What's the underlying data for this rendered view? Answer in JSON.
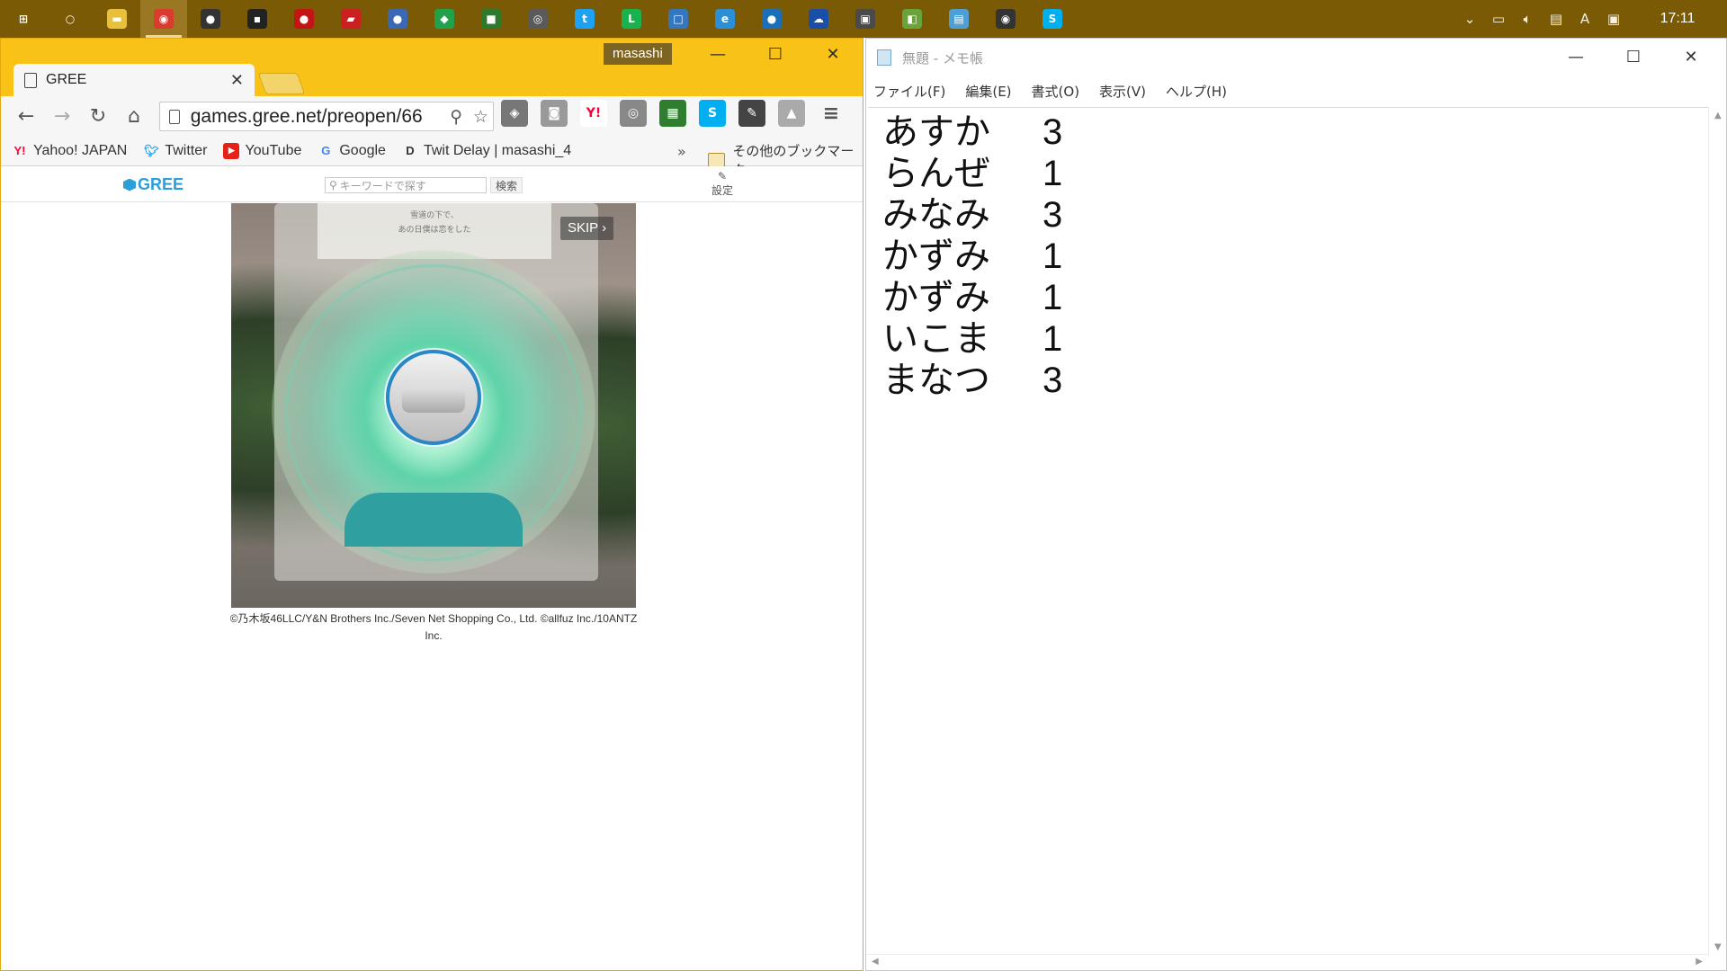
{
  "taskbar": {
    "items": [
      {
        "name": "start",
        "label": "⊞",
        "color": "#7a5a05"
      },
      {
        "name": "cortana",
        "label": "○",
        "color": "#7a5a05"
      },
      {
        "name": "explorer",
        "label": "▬",
        "color": "#e8c03c"
      },
      {
        "name": "chrome",
        "label": "◉",
        "color": "#d93b2f"
      },
      {
        "name": "app-1",
        "label": "●",
        "color": "#333333"
      },
      {
        "name": "app-2",
        "label": "▪",
        "color": "#222222"
      },
      {
        "name": "app-3",
        "label": "●",
        "color": "#c41515"
      },
      {
        "name": "app-4",
        "label": "▰",
        "color": "#cc2020"
      },
      {
        "name": "app-5",
        "label": "●",
        "color": "#3a68b5"
      },
      {
        "name": "app-6",
        "label": "◆",
        "color": "#22a14b"
      },
      {
        "name": "app-7",
        "label": "■",
        "color": "#2d7a2d"
      },
      {
        "name": "app-8",
        "label": "◎",
        "color": "#5a5a5a"
      },
      {
        "name": "twitter",
        "label": "t",
        "color": "#1da1f2"
      },
      {
        "name": "line",
        "label": "L",
        "color": "#19b24f"
      },
      {
        "name": "app-9",
        "label": "□",
        "color": "#3277c0"
      },
      {
        "name": "ie",
        "label": "e",
        "color": "#2a8fd6"
      },
      {
        "name": "app-10",
        "label": "●",
        "color": "#1a6fb8"
      },
      {
        "name": "onedrive",
        "label": "☁",
        "color": "#1a4fa8"
      },
      {
        "name": "app-11",
        "label": "▣",
        "color": "#4a4a4a"
      },
      {
        "name": "app-12",
        "label": "◧",
        "color": "#6aa33c"
      },
      {
        "name": "notepad",
        "label": "▤",
        "color": "#4d9fd6"
      },
      {
        "name": "app-13",
        "label": "◉",
        "color": "#333333"
      },
      {
        "name": "skype",
        "label": "S",
        "color": "#00aff0"
      }
    ],
    "active_index": 3,
    "clock": "17:11"
  },
  "chrome": {
    "profile_name": "masashi",
    "tab_title": "GREE",
    "url": "games.gree.net/preopen/66",
    "bookmarks": [
      {
        "label": "Yahoo! JAPAN",
        "icon": "Y!",
        "color": "#ff0033"
      },
      {
        "label": "Twitter",
        "icon": "t",
        "color": "#1da1f2"
      },
      {
        "label": "YouTube",
        "icon": "▶",
        "color": "#e62117"
      },
      {
        "label": "Google",
        "icon": "G",
        "color": "#4285f4"
      },
      {
        "label": "Twit Delay | masashi_4",
        "icon": "D",
        "color": "#333333"
      }
    ],
    "bookmarks_more": "»",
    "other_bookmarks": "その他のブックマーク",
    "gree": {
      "logo": "GREE",
      "search_placeholder": "キーワードで探す",
      "search_button": "検索",
      "settings": "設定"
    },
    "game": {
      "top_text_1": "雪道の下で、",
      "top_text_2": "あの日僕は恋をした",
      "skip": "SKIP ›"
    },
    "copyright_1": "©乃木坂46LLC/Y&N Brothers Inc./Seven Net Shopping Co., Ltd. ©allfuz Inc./10ANTZ",
    "copyright_2": "Inc."
  },
  "notepad": {
    "title": "無題 - メモ帳",
    "menu": [
      "ファイル(F)",
      "編集(E)",
      "書式(O)",
      "表示(V)",
      "ヘルプ(H)"
    ],
    "lines": [
      {
        "name": "あすか",
        "score": "3"
      },
      {
        "name": "らんぜ",
        "score": "1"
      },
      {
        "name": "みなみ",
        "score": "3"
      },
      {
        "name": "かずみ",
        "score": "1"
      },
      {
        "name": "かずみ",
        "score": "1"
      },
      {
        "name": "いこま",
        "score": "1"
      },
      {
        "name": "まなつ",
        "score": "3"
      }
    ]
  }
}
